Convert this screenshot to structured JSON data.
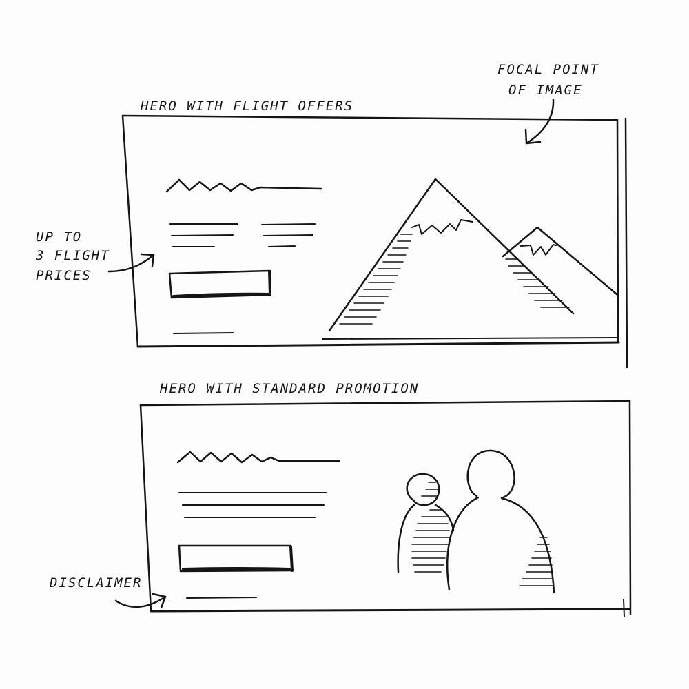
{
  "wireframes": {
    "flight_offers": {
      "title": "HERO WITH FLIGHT OFFERS"
    },
    "standard_promotion": {
      "title": "HERO WITH STANDARD PROMOTION"
    }
  },
  "annotations": {
    "focal_point_line1": "FOCAL POINT",
    "focal_point_line2": "OF IMAGE",
    "flight_prices_line1": "UP TO",
    "flight_prices_line2": "3 FLIGHT",
    "flight_prices_line3": "PRICES",
    "disclaimer": "DISCLAIMER"
  },
  "colors": {
    "ink": "#151515",
    "paper": "#fdfdfd"
  }
}
